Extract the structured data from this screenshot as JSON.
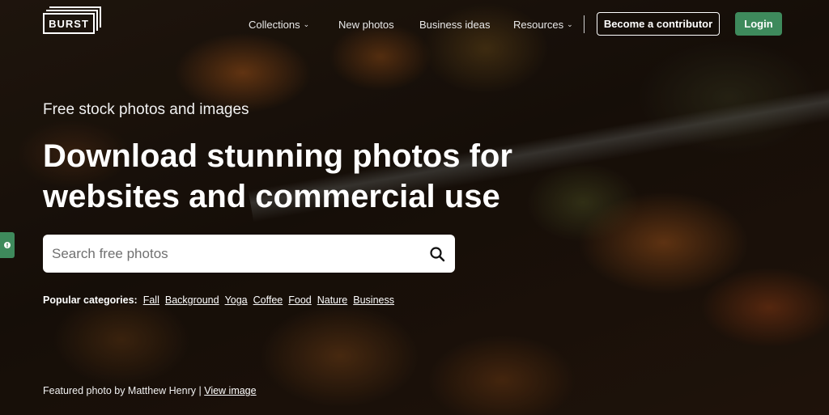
{
  "brand": {
    "logo_text": "BURST"
  },
  "nav": {
    "collections": "Collections",
    "new_photos": "New photos",
    "business_ideas": "Business ideas",
    "resources": "Resources",
    "contributor_button": "Become a contributor",
    "login_button": "Login"
  },
  "hero": {
    "eyebrow": "Free stock photos and images",
    "headline": "Download stunning photos for websites and commercial use",
    "search": {
      "placeholder": "Search free photos",
      "value": ""
    },
    "popular_label": "Popular categories:",
    "categories": [
      "Fall",
      "Background",
      "Yoga",
      "Coffee",
      "Food",
      "Nature",
      "Business"
    ],
    "credit_prefix": "Featured photo by Matthew Henry |",
    "credit_link": "View image"
  },
  "colors": {
    "accent_green": "#3e8a5c",
    "text_white": "#ffffff"
  },
  "icons": {
    "search": "search-icon",
    "dropdown": "chevron-down-icon",
    "feedback": "feedback-icon"
  }
}
